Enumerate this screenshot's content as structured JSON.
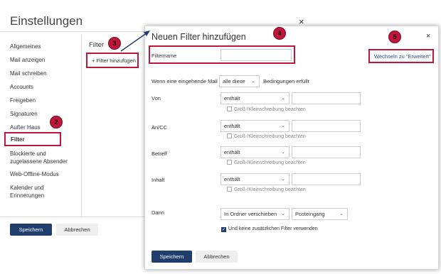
{
  "settings": {
    "title": "Einstellungen",
    "close_glyph": "×",
    "sidebar_items": [
      "Allgemeines",
      "Mail anzeigen",
      "Mail schreiben",
      "Accounts",
      "Freigeben",
      "Signaturen",
      "Außer Haus",
      "Filter",
      "Blockierte und zugelassene Absender",
      "Web-Offline-Modus",
      "Kalender und Erinnerungen"
    ],
    "active_item": "Filter",
    "filter_header": "Filter",
    "add_filter_label": "+ Filter hinzufügen",
    "save_label": "Speichern",
    "cancel_label": "Abbrechen"
  },
  "dialog": {
    "title": "Neuen Filter hinzufügen",
    "close_glyph": "×",
    "name_label": "Filtername",
    "name_value": "",
    "advanced_label": "Wechseln zu \"Erweitert\"",
    "condition_prefix": "Wenn eine eingehende Mail",
    "condition_mode": "alle diese",
    "condition_suffix": "Bedingungen erfüllt",
    "conditions": [
      {
        "field": "Von",
        "operator": "enthält",
        "value": "",
        "case_label": "Groß-/Kleinschreibung beachten"
      },
      {
        "field": "An/CC",
        "operator": "enthält",
        "value": "",
        "case_label": "Groß-/Kleinschreibung beachten"
      },
      {
        "field": "Betreff",
        "operator": "enthält",
        "value": "",
        "case_label": "Groß-/Kleinschreibung beachten"
      },
      {
        "field": "Inhalt",
        "operator": "enthält",
        "value": "",
        "case_label": "Groß-/Kleinschreibung beachten"
      }
    ],
    "then_label": "Dann",
    "action": "In Ordner verschieben",
    "target_folder": "Posteingang",
    "stop_label": "Und keine zusätzlichen Filter verwenden",
    "stop_checked": true,
    "save_label": "Speichern",
    "cancel_label": "Abbrechen"
  },
  "badges": [
    "2",
    "3",
    "4",
    "5"
  ],
  "colors": {
    "highlight": "#c0163a",
    "primary_button": "#1f3e6e",
    "link": "#1f4e8e"
  }
}
